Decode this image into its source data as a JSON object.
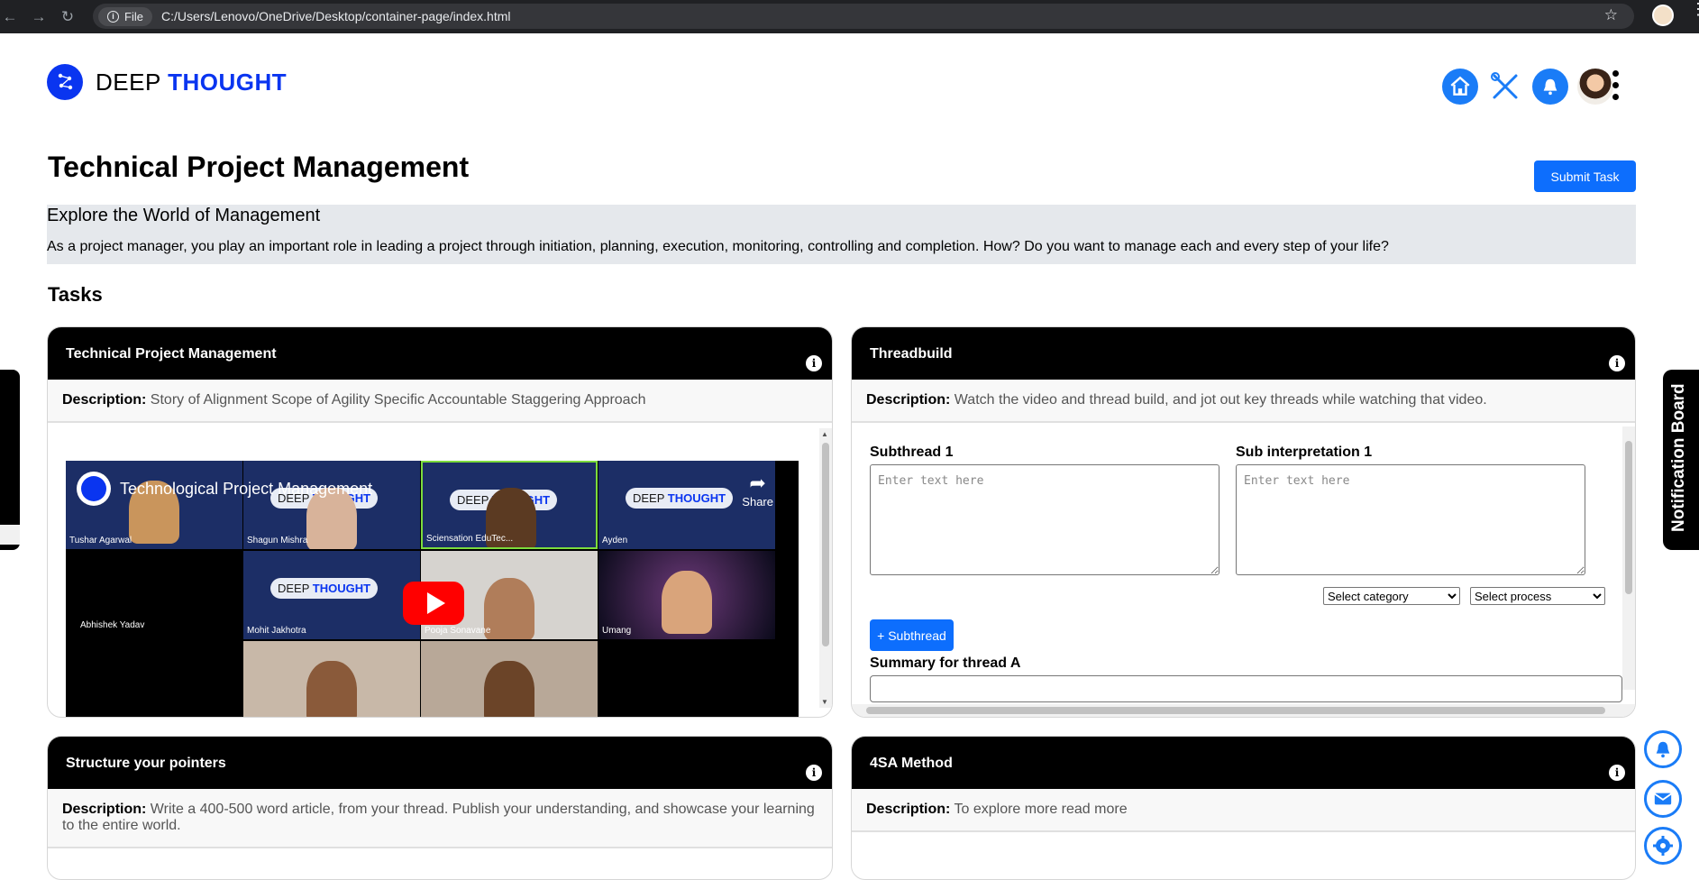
{
  "browser": {
    "file_label": "File",
    "url": "C:/Users/Lenovo/OneDrive/Desktop/container-page/index.html"
  },
  "brand": {
    "name_part1": "DEEP",
    "name_part2": "THOUGHT"
  },
  "page": {
    "title": "Technical Project Management",
    "submit_label": "Submit Task",
    "intro_heading": "Explore the World of Management",
    "intro_text": "As a project manager, you play an important role in leading a project through initiation, planning, execution, monitoring, controlling and completion. How? Do you want to manage each and every step of your life?",
    "tasks_heading": "Tasks"
  },
  "cards": [
    {
      "title": "Technical Project Management",
      "desc_label": "Description:",
      "desc": "Story of Alignment Scope of Agility Specific Accountable Staggering Approach"
    },
    {
      "title": "Threadbuild",
      "desc_label": "Description:",
      "desc": "Watch the video and thread build, and jot out key threads while watching that video."
    },
    {
      "title": "Structure your pointers",
      "desc_label": "Description:",
      "desc": "Write a 400-500 word article, from your thread. Publish your understanding, and showcase your learning to the entire world."
    },
    {
      "title": "4SA Method",
      "desc_label": "Description:",
      "desc": "To explore more read more"
    }
  ],
  "video": {
    "title": "Technological Project Management",
    "share": "Share",
    "participants": [
      "Tushar Agarwal",
      "Shagun Mishra",
      "Sciensation EduTec...",
      "Ayden",
      "Abhishek Yadav",
      "Mohit Jakhotra",
      "Pooja Sonavane",
      "Umang"
    ],
    "watermark_1": "DEEP",
    "watermark_2": "THOUGHT"
  },
  "threadbuild": {
    "subthread_label": "Subthread 1",
    "interp_label": "Sub interpretation 1",
    "placeholder": "Enter text here",
    "category": "Select category",
    "process": "Select process",
    "add_subthread": "+ Subthread",
    "summary_label": "Summary for thread A"
  },
  "notification_board": "Notification Board",
  "colors": {
    "brand_blue": "#0a35f0",
    "accent_blue": "#1a7cf7",
    "button_blue": "#0d6efd"
  }
}
